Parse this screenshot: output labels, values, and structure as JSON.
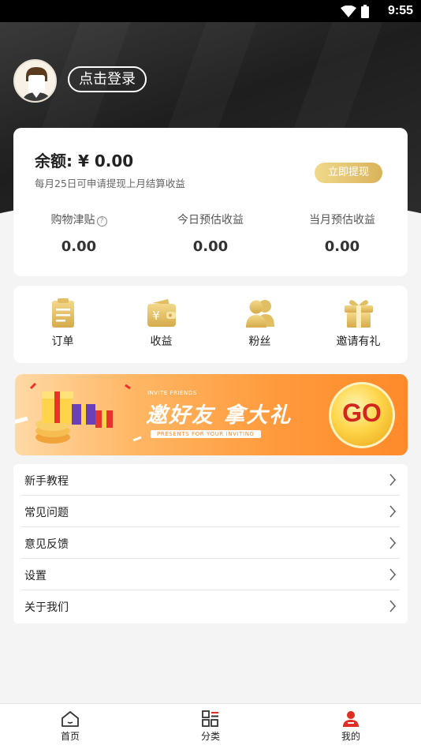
{
  "status_bar": {
    "time": "9:55"
  },
  "header": {
    "login_label": "点击登录"
  },
  "balance": {
    "title": "余额: ¥ 0.00",
    "subtitle": "每月25日可申请提现上月结算收益",
    "withdraw_label": "立即提现",
    "stats": [
      {
        "label": "购物津贴",
        "value": "0.00",
        "help_icon": "?"
      },
      {
        "label": "今日预估收益",
        "value": "0.00"
      },
      {
        "label": "当月预估收益",
        "value": "0.00"
      }
    ]
  },
  "quick_menu": [
    {
      "label": "订单",
      "icon": "clipboard-icon"
    },
    {
      "label": "收益",
      "icon": "wallet-icon"
    },
    {
      "label": "粉丝",
      "icon": "users-icon"
    },
    {
      "label": "邀请有礼",
      "icon": "gift-icon"
    }
  ],
  "banner": {
    "small_text": "INVITE FRIENDS",
    "headline": "邀好友 拿大礼",
    "presents": "PRESENTS FOR YOUR INVITING",
    "go_label": "GO"
  },
  "list": [
    {
      "label": "新手教程"
    },
    {
      "label": "常见问题"
    },
    {
      "label": "意见反馈"
    },
    {
      "label": "设置"
    },
    {
      "label": "关于我们"
    }
  ],
  "tabbar": [
    {
      "label": "首页",
      "icon": "home-icon"
    },
    {
      "label": "分类",
      "icon": "category-icon"
    },
    {
      "label": "我的",
      "icon": "profile-icon",
      "active": true
    }
  ],
  "colors": {
    "gold": "#d9b35a",
    "accent_red": "#e02e24",
    "header_dark": "#1e1e1e"
  }
}
